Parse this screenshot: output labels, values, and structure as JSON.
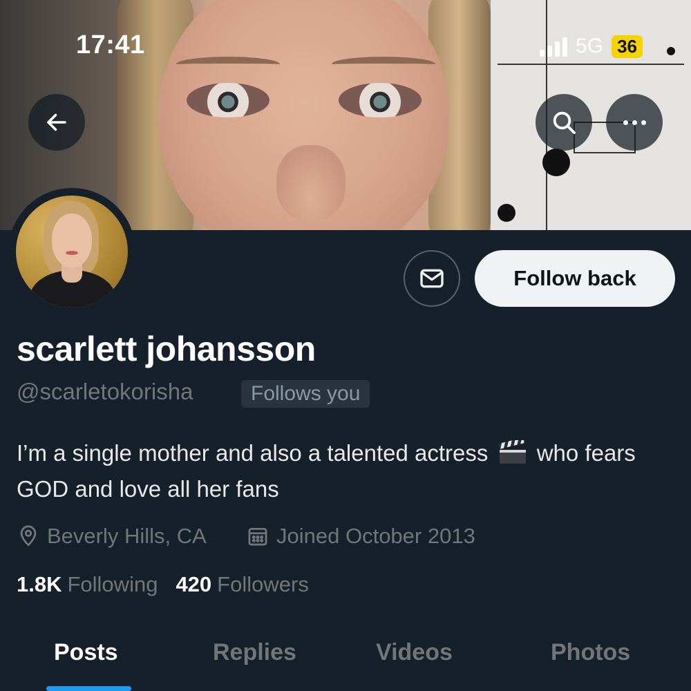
{
  "status_bar": {
    "time": "17:41",
    "network": "5G",
    "battery": "36"
  },
  "header": {
    "back_icon": "back-arrow-icon",
    "search_icon": "search-icon",
    "more_icon": "more-icon"
  },
  "profile": {
    "display_name": "scarlett johansson",
    "handle": "@scarletokorisha",
    "follows_you_badge": "Follows you",
    "bio_part1": "I’m a single mother and also a talented actress",
    "bio_emoji": "clapper-board-icon",
    "bio_part2": "who fears GOD and love all her fans",
    "location": "Beverly Hills, CA",
    "joined": "Joined October 2013",
    "following_count": "1.8K",
    "following_label": "Following",
    "followers_count": "420",
    "followers_label": "Followers"
  },
  "actions": {
    "message_icon": "envelope-icon",
    "follow_back_label": "Follow back"
  },
  "tabs": [
    {
      "label": "Posts",
      "active": true
    },
    {
      "label": "Replies",
      "active": false
    },
    {
      "label": "Videos",
      "active": false
    },
    {
      "label": "Photos",
      "active": false
    }
  ],
  "colors": {
    "background": "#16202b",
    "accent": "#1d9bf0",
    "muted_text": "#71767b",
    "battery": "#f5d200"
  }
}
